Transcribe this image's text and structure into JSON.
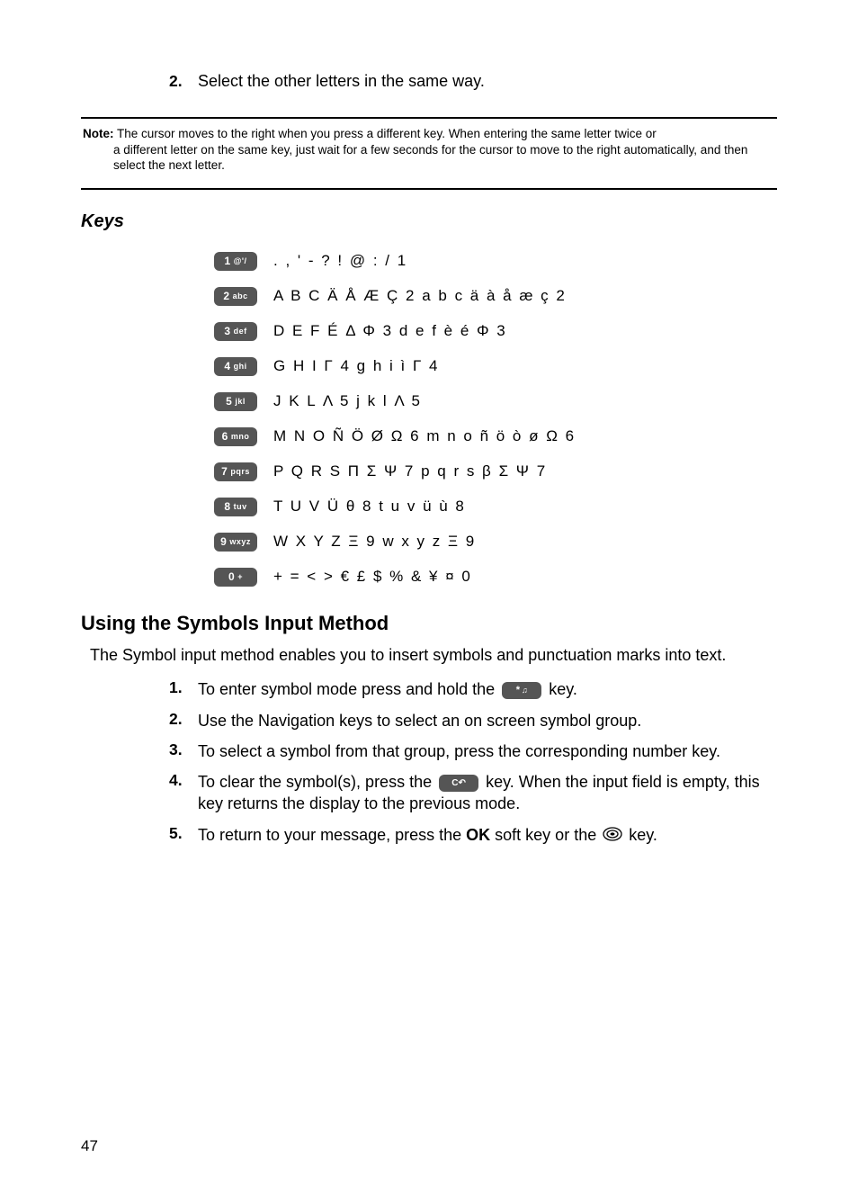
{
  "top_step": {
    "num": "2.",
    "text": "Select the other letters in the same way."
  },
  "note": {
    "label": "Note:",
    "text_first": "The cursor moves to the right when you press a different key. When entering the same letter twice or",
    "text_rest": "a different letter on the same key, just wait for a few seconds for the cursor to move to the right automatically, and then select the next letter."
  },
  "keys_label": "Keys",
  "keys": [
    {
      "btn_big": "1",
      "btn_small": "@'/",
      "chars": ". , ' - ? ! @ : / 1"
    },
    {
      "btn_big": "2",
      "btn_small": "abc",
      "chars": "A B C Ä Å Æ Ç 2 a b c ä à å æ ç 2"
    },
    {
      "btn_big": "3",
      "btn_small": "def",
      "chars": "D E F É Δ Φ 3 d e f è é Φ 3"
    },
    {
      "btn_big": "4",
      "btn_small": "ghi",
      "chars": "G H I Γ 4 g h i ì Γ 4"
    },
    {
      "btn_big": "5",
      "btn_small": "jkl",
      "chars": "J K L Λ 5 j k l Λ 5"
    },
    {
      "btn_big": "6",
      "btn_small": "mno",
      "chars": "M N O Ñ Ö Ø Ω 6 m n o ñ ö ò ø Ω 6"
    },
    {
      "btn_big": "7",
      "btn_small": "pqrs",
      "chars": "P Q R S Π Σ Ψ 7 p q r s β Σ Ψ 7"
    },
    {
      "btn_big": "8",
      "btn_small": "tuv",
      "chars": "T U V Ü θ 8 t u v ü ù 8"
    },
    {
      "btn_big": "9",
      "btn_small": "wxyz",
      "chars": "W X Y Z Ξ 9 w x y z Ξ 9"
    },
    {
      "btn_big": "0",
      "btn_small": "+",
      "chars": "+ = < > € £ $ % & ¥ ¤ 0"
    }
  ],
  "heading": "Using the Symbols Input Method",
  "intro": "The Symbol input method enables you to insert symbols and punctuation marks into text.",
  "steps": [
    {
      "num": "1.",
      "pre": "To enter symbol mode press and hold the ",
      "key_big": "*",
      "key_small": "♫",
      "post": " key."
    },
    {
      "num": "2.",
      "text": "Use the Navigation keys to select an on screen symbol group."
    },
    {
      "num": "3.",
      "text": "To select a symbol from that group, press the corresponding number key."
    },
    {
      "num": "4.",
      "pre": "To clear the symbol(s), press the ",
      "ckey": "C↶",
      "post": " key. When the input field is empty, this key returns the display to the previous mode."
    },
    {
      "num": "5.",
      "pre": "To return to your message, press the ",
      "ok": "OK",
      "mid": " soft key or the ",
      "post": " key."
    }
  ],
  "page_number": "47"
}
